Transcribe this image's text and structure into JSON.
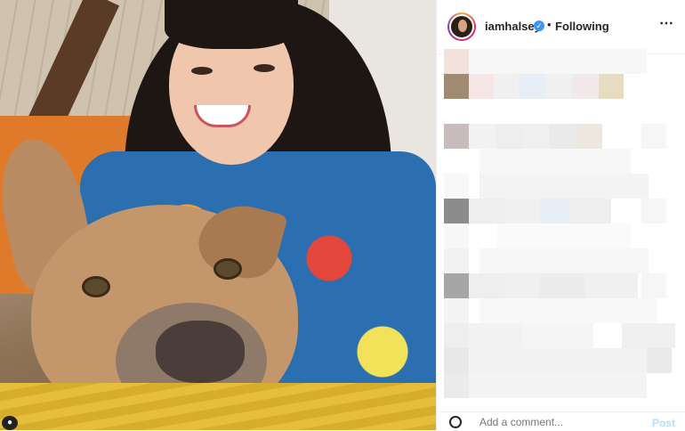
{
  "header": {
    "username": "iamhalsey",
    "separator": "•",
    "follow_status": "Following",
    "more_icon": "⋯"
  },
  "verified_icon": "✓",
  "comment_bar": {
    "placeholder": "Add a comment...",
    "post_label": "Post"
  },
  "colors": {
    "verified": "#3897f0",
    "post_disabled": "#b2dffc",
    "text": "#262626"
  }
}
